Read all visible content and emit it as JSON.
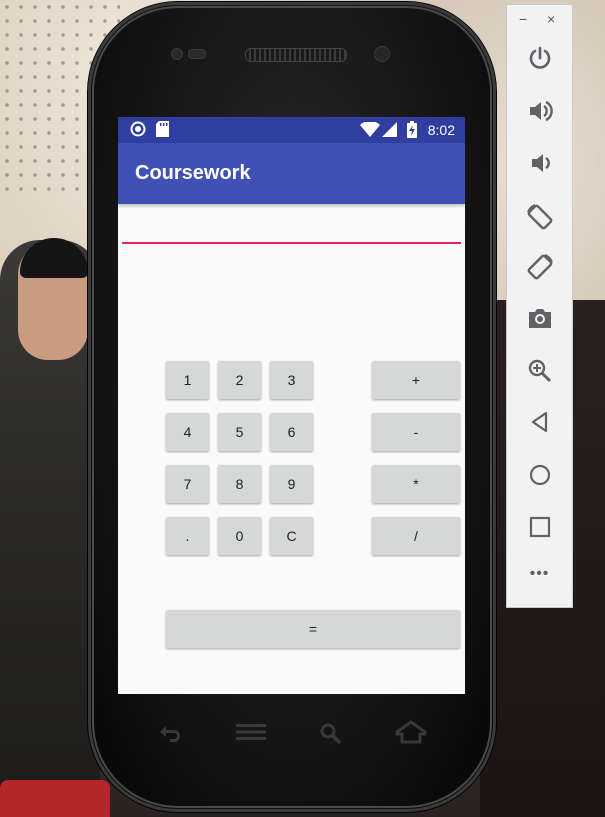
{
  "statusbar": {
    "time": "8:02"
  },
  "app": {
    "title": "Coursework"
  },
  "keypad": {
    "digits": [
      "1",
      "2",
      "3",
      "4",
      "5",
      "6",
      "7",
      "8",
      "9",
      ".",
      "0",
      "C"
    ],
    "operators": [
      "+",
      "-",
      "*",
      "/"
    ],
    "equals": "="
  },
  "panel": {
    "minimize": "−",
    "close": "×",
    "icons": [
      "power-icon",
      "volume-up-icon",
      "volume-down-icon",
      "rotate-left-icon",
      "rotate-right-icon",
      "camera-icon",
      "zoom-icon",
      "back-icon",
      "home-icon",
      "overview-icon",
      "more-icon"
    ],
    "more_label": "•••"
  },
  "colors": {
    "statusbar": "#303f9f",
    "appbar": "#3f51b5",
    "accent": "#e91e63",
    "button": "#d6d7d7"
  }
}
